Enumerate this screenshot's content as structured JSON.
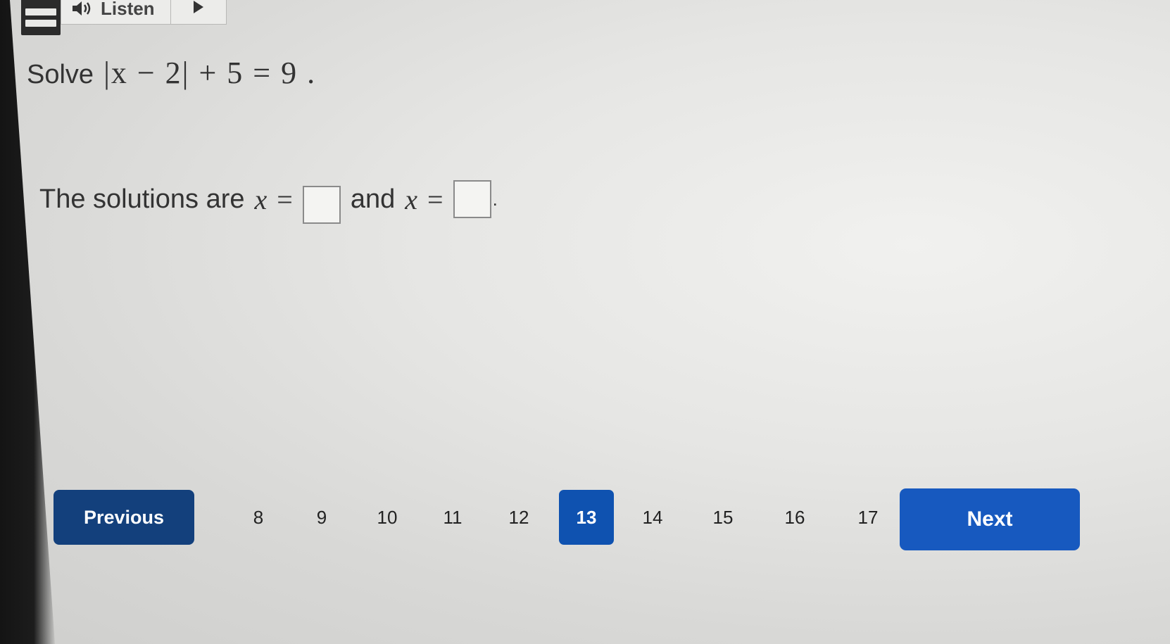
{
  "toolbar": {
    "listen_label": "Listen",
    "speaker_icon": "speaker-icon",
    "play_icon": "play-icon"
  },
  "question": {
    "solve_label": "Solve",
    "equation": "|x − 2| + 5 = 9 .",
    "solutions_prefix": "The solutions are",
    "variable": "x",
    "equals": "=",
    "and_label": "and",
    "period": ".",
    "answer_1": "",
    "answer_2": ""
  },
  "navigation": {
    "previous_label": "Previous",
    "next_label": "Next",
    "pages": [
      "8",
      "9",
      "10",
      "11",
      "12",
      "13",
      "14",
      "15",
      "16",
      "17"
    ],
    "current_page": "13"
  },
  "colors": {
    "previous_button": "#13407c",
    "current_page": "#0f52b0",
    "next_button": "#1759bf"
  }
}
